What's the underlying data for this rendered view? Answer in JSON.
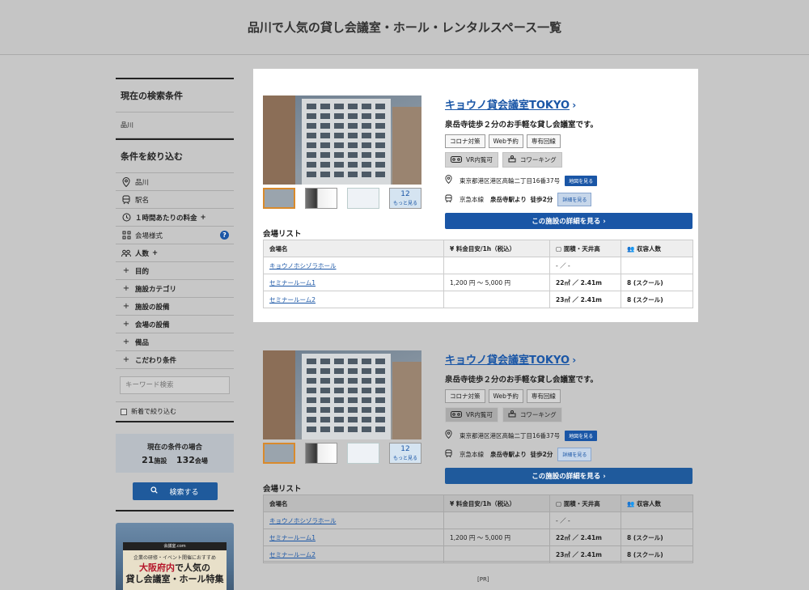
{
  "header": {
    "title": "品川で人気の貸し会議室・ホール・レンタルスペース一覧"
  },
  "sidebar": {
    "current_conditions_title": "現在の検索条件",
    "current_area": "品川",
    "filter_title": "条件を絞り込む",
    "filters": [
      {
        "icon": "map-pin-icon",
        "label": "品川",
        "plus": ""
      },
      {
        "icon": "train-icon",
        "label": "駅名",
        "plus": ""
      },
      {
        "icon": "clock-icon",
        "label": "１時間あたりの料金",
        "plus": "+"
      },
      {
        "icon": "layout-icon",
        "label": "会場様式",
        "plus": "",
        "help": "?"
      },
      {
        "icon": "people-icon",
        "label": "人数",
        "plus": "+"
      },
      {
        "icon": "plus-icon",
        "label": "目的",
        "plus": ""
      },
      {
        "icon": "plus-icon",
        "label": "施設カテゴリ",
        "plus": ""
      },
      {
        "icon": "plus-icon",
        "label": "施設の設備",
        "plus": ""
      },
      {
        "icon": "plus-icon",
        "label": "会場の設備",
        "plus": ""
      },
      {
        "icon": "plus-icon",
        "label": "備品",
        "plus": ""
      },
      {
        "icon": "plus-icon",
        "label": "こだわり条件",
        "plus": ""
      }
    ],
    "keyword_placeholder": "キーワード検索",
    "new_only_label": "新着で絞り込む",
    "condition_box_label": "現在の条件の場合",
    "facility_count": "21",
    "facility_unit": "施設",
    "hall_count": "132",
    "hall_unit": "会場",
    "search_button": "検索する",
    "banner": {
      "logo": "会議室.com",
      "subtitle": "企業の研修・イベント開催におすすめ",
      "main_red": "大阪府内",
      "main_rest": "で人気の",
      "main_line2": "貸し会議室・ホール特集"
    }
  },
  "cards": [
    {
      "name": "キョウノ貸会議室TOKYO",
      "catch": "泉岳寺徒歩２分のお手軽な貸し会議室です。",
      "tags": [
        "コロナ対策",
        "Web予約",
        "専有回線"
      ],
      "tags2": [
        {
          "icon": "vr-icon",
          "label": "VR内覧可"
        },
        {
          "icon": "coworking-icon",
          "label": "コワーキング"
        }
      ],
      "address": "東京都港区港区高輪二丁目16番37号",
      "map_button": "地図を見る",
      "line": "京急本線",
      "station": "泉岳寺駅より",
      "walk": "徒歩2分",
      "detail_button": "詳細を見る",
      "main_button": "この施設の詳細を見る ›",
      "more_count": "12",
      "more_label": "もっと見る",
      "hall_list_title": "会場リスト",
      "headers": [
        "会場名",
        "料金目安/1h（税込）",
        "面積・天井高",
        "収容人数"
      ],
      "rows": [
        {
          "name": "キョウノホシゾラホール",
          "price": "",
          "area": "- ／ -",
          "cap": ""
        },
        {
          "name": "セミナールーム1",
          "price": "1,200 円 〜 5,000 円",
          "area": "22㎡ ／ 2.41m",
          "cap": "8 (スクール)"
        },
        {
          "name": "セミナールーム2",
          "price": "",
          "area": "23㎡ ／ 2.41m",
          "cap": "8 (スクール)"
        }
      ]
    },
    {
      "name": "キョウノ貸会議室TOKYO",
      "catch": "泉岳寺徒歩２分のお手軽な貸し会議室です。",
      "tags": [
        "コロナ対策",
        "Web予約",
        "専有回線"
      ],
      "tags2": [
        {
          "icon": "vr-icon",
          "label": "VR内覧可"
        },
        {
          "icon": "coworking-icon",
          "label": "コワーキング"
        }
      ],
      "address": "東京都港区港区高輪二丁目16番37号",
      "map_button": "地図を見る",
      "line": "京急本線",
      "station": "泉岳寺駅より",
      "walk": "徒歩2分",
      "detail_button": "詳細を見る",
      "main_button": "この施設の詳細を見る ›",
      "more_count": "12",
      "more_label": "もっと見る",
      "hall_list_title": "会場リスト",
      "headers": [
        "会場名",
        "料金目安/1h（税込）",
        "面積・天井高",
        "収容人数"
      ],
      "rows": [
        {
          "name": "キョウノホシゾラホール",
          "price": "",
          "area": "- ／ -",
          "cap": ""
        },
        {
          "name": "セミナールーム1",
          "price": "1,200 円 〜 5,000 円",
          "area": "22㎡ ／ 2.41m",
          "cap": "8 (スクール)"
        },
        {
          "name": "セミナールーム2",
          "price": "",
          "area": "23㎡ ／ 2.41m",
          "cap": "8 (スクール)"
        }
      ]
    }
  ],
  "footer": {
    "pr": "[PR]"
  }
}
